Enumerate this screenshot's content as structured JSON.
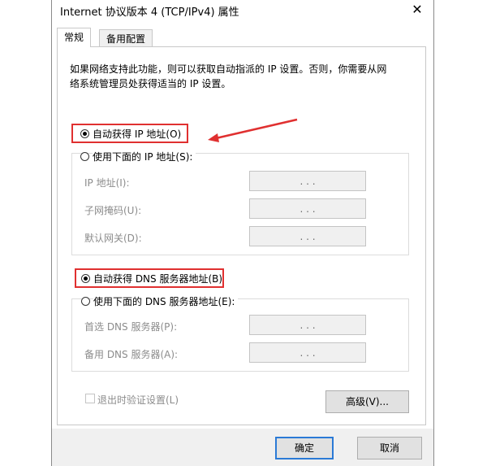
{
  "window": {
    "title": "Internet 协议版本 4 (TCP/IPv4) 属性",
    "close_glyph": "✕"
  },
  "tabs": [
    {
      "label": "常规"
    },
    {
      "label": "备用配置"
    }
  ],
  "description": "如果网络支持此功能，则可以获取自动指派的 IP 设置。否则，你需要从网络系统管理员处获得适当的 IP 设置。",
  "ip": {
    "auto_label": "自动获得 IP 地址(O)",
    "manual_label": "使用下面的 IP 地址(S):",
    "fields": [
      {
        "label": "IP 地址(I):",
        "value": ".   .   ."
      },
      {
        "label": "子网掩码(U):",
        "value": ".   .   ."
      },
      {
        "label": "默认网关(D):",
        "value": ".   .   ."
      }
    ]
  },
  "dns": {
    "auto_label": "自动获得 DNS 服务器地址(B)",
    "manual_label": "使用下面的 DNS 服务器地址(E):",
    "fields": [
      {
        "label": "首选 DNS 服务器(P):",
        "value": ".   .   ."
      },
      {
        "label": "备用 DNS 服务器(A):",
        "value": ".   .   ."
      }
    ]
  },
  "validate_label": "退出时验证设置(L)",
  "advanced_label": "高级(V)...",
  "ok_label": "确定",
  "cancel_label": "取消",
  "colors": {
    "highlight": "#e03030",
    "accent": "#2b7ad6"
  }
}
